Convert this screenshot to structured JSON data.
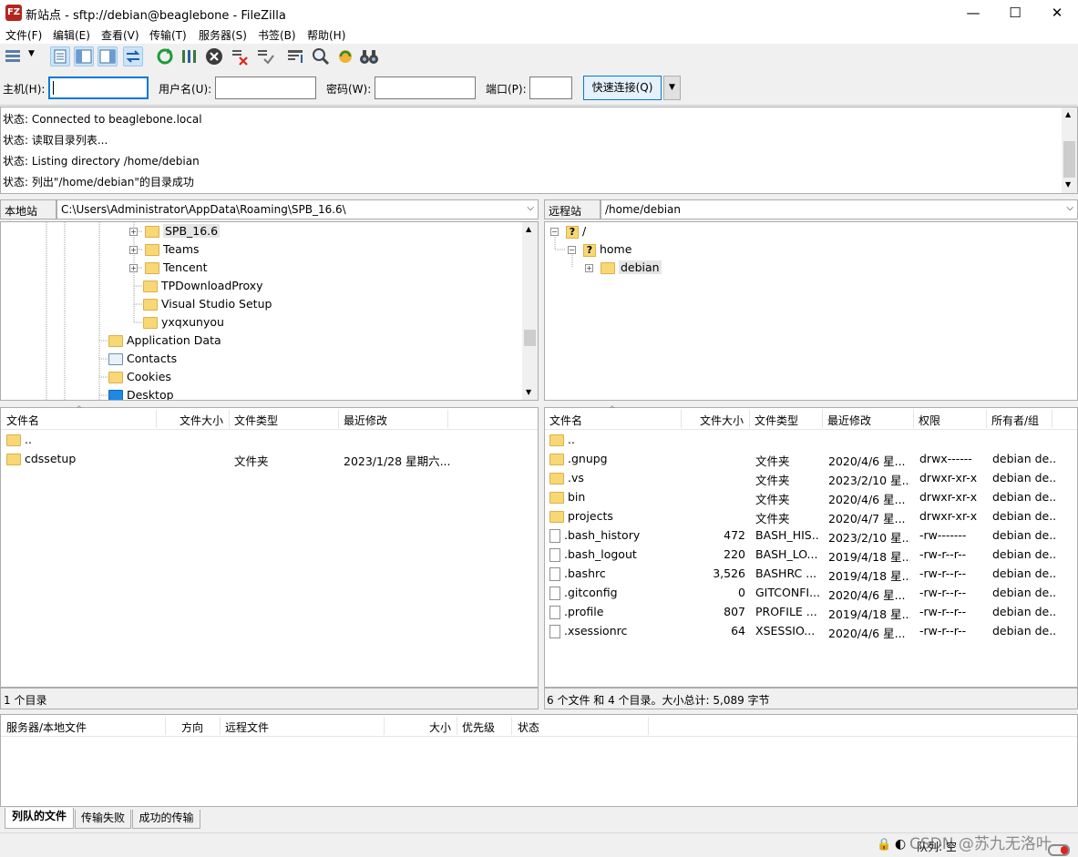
{
  "window": {
    "title": "新站点 - sftp://debian@beaglebone - FileZilla",
    "app_icon": "FZ",
    "minimize": "—",
    "maximize": "☐",
    "close": "✕"
  },
  "menu": [
    "文件(F)",
    "编辑(E)",
    "查看(V)",
    "传输(T)",
    "服务器(S)",
    "书签(B)",
    "帮助(H)"
  ],
  "quickconnect": {
    "host_label": "主机(H):",
    "user_label": "用户名(U):",
    "pass_label": "密码(W):",
    "port_label": "端口(P):",
    "button": "快速连接(Q)",
    "dropdown": "▼"
  },
  "log": [
    "状态: Connected to beaglebone.local",
    "状态: 读取目录列表...",
    "状态: Listing directory /home/debian",
    "状态: 列出\"/home/debian\"的目录成功"
  ],
  "local": {
    "site_label": "本地站点:",
    "path": "C:\\Users\\Administrator\\AppData\\Roaming\\SPB_16.6\\",
    "tree": [
      {
        "name": "SPB_16.6",
        "expander": "+",
        "selected": true
      },
      {
        "name": "Teams",
        "expander": "+"
      },
      {
        "name": "Tencent",
        "expander": "+"
      },
      {
        "name": "TPDownloadProxy",
        "expander": ""
      },
      {
        "name": "Visual Studio Setup",
        "expander": ""
      },
      {
        "name": "yxqxunyou",
        "expander": ""
      },
      {
        "name": "Application Data",
        "expander": ""
      },
      {
        "name": "Contacts",
        "expander": ""
      },
      {
        "name": "Cookies",
        "expander": ""
      },
      {
        "name": "Desktop",
        "expander": ""
      }
    ],
    "columns": [
      "文件名",
      "文件大小",
      "文件类型",
      "最近修改"
    ],
    "files": [
      {
        "name": "..",
        "size": "",
        "type": "",
        "modified": ""
      },
      {
        "name": "cdssetup",
        "size": "",
        "type": "文件夹",
        "modified": "2023/1/28 星期六..."
      }
    ],
    "status": "1 个目录"
  },
  "remote": {
    "site_label": "远程站点:",
    "path": "/home/debian",
    "tree": [
      {
        "name": "/",
        "expander": "−"
      },
      {
        "name": "home",
        "expander": "−"
      },
      {
        "name": "debian",
        "expander": "+"
      }
    ],
    "columns": [
      "文件名",
      "文件大小",
      "文件类型",
      "最近修改",
      "权限",
      "所有者/组"
    ],
    "files": [
      {
        "name": "..",
        "size": "",
        "type": "",
        "modified": "",
        "perm": "",
        "owner": "",
        "dir": true
      },
      {
        "name": ".gnupg",
        "size": "",
        "type": "文件夹",
        "modified": "2020/4/6 星...",
        "perm": "drwx------",
        "owner": "debian de...",
        "dir": true
      },
      {
        "name": ".vs",
        "size": "",
        "type": "文件夹",
        "modified": "2023/2/10 星...",
        "perm": "drwxr-xr-x",
        "owner": "debian de...",
        "dir": true
      },
      {
        "name": "bin",
        "size": "",
        "type": "文件夹",
        "modified": "2020/4/6 星...",
        "perm": "drwxr-xr-x",
        "owner": "debian de...",
        "dir": true
      },
      {
        "name": "projects",
        "size": "",
        "type": "文件夹",
        "modified": "2020/4/7 星...",
        "perm": "drwxr-xr-x",
        "owner": "debian de...",
        "dir": true
      },
      {
        "name": ".bash_history",
        "size": "472",
        "type": "BASH_HIS...",
        "modified": "2023/2/10 星...",
        "perm": "-rw-------",
        "owner": "debian de...",
        "dir": false
      },
      {
        "name": ".bash_logout",
        "size": "220",
        "type": "BASH_LO...",
        "modified": "2019/4/18 星...",
        "perm": "-rw-r--r--",
        "owner": "debian de...",
        "dir": false
      },
      {
        "name": ".bashrc",
        "size": "3,526",
        "type": "BASHRC ...",
        "modified": "2019/4/18 星...",
        "perm": "-rw-r--r--",
        "owner": "debian de...",
        "dir": false
      },
      {
        "name": ".gitconfig",
        "size": "0",
        "type": "GITCONFI...",
        "modified": "2020/4/6 星...",
        "perm": "-rw-r--r--",
        "owner": "debian de...",
        "dir": false
      },
      {
        "name": ".profile",
        "size": "807",
        "type": "PROFILE ...",
        "modified": "2019/4/18 星...",
        "perm": "-rw-r--r--",
        "owner": "debian de...",
        "dir": false
      },
      {
        "name": ".xsessionrc",
        "size": "64",
        "type": "XSESSIO...",
        "modified": "2020/4/6 星...",
        "perm": "-rw-r--r--",
        "owner": "debian de...",
        "dir": false
      }
    ],
    "status": "6 个文件 和 4 个目录。大小总计: 5,089 字节"
  },
  "queue": {
    "columns": [
      "服务器/本地文件",
      "方向",
      "远程文件",
      "大小",
      "优先级",
      "状态"
    ]
  },
  "tabs": [
    "列队的文件",
    "传输失败",
    "成功的传输"
  ],
  "bottom": {
    "queue_status": "队列: 空",
    "watermark": "CSDN @苏九无洛叶"
  },
  "colors": {
    "accent": "#0078d7",
    "folder": "#f8d775"
  }
}
